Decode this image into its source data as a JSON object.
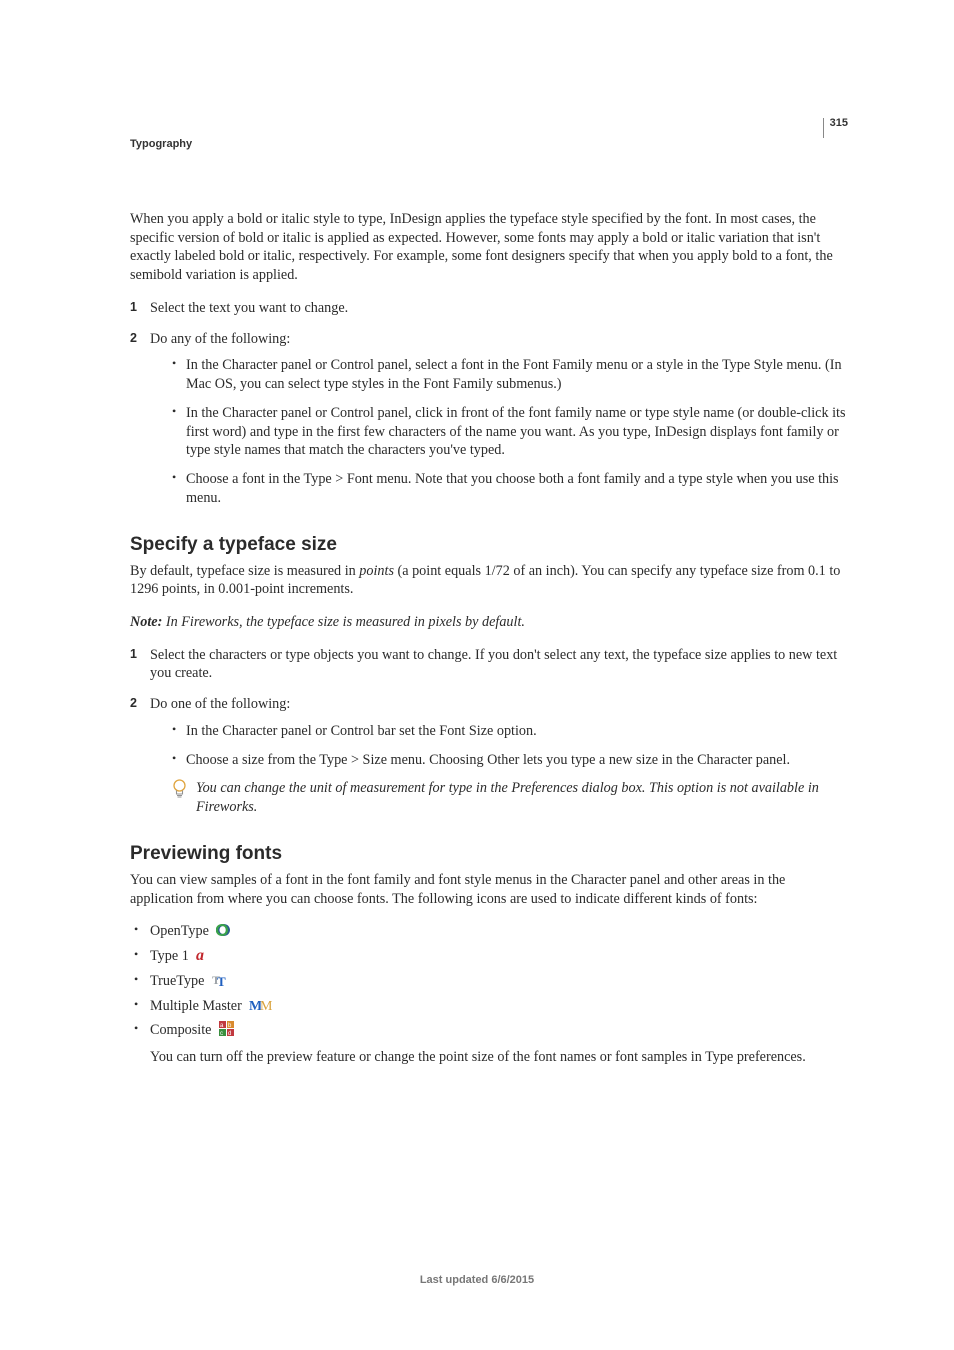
{
  "page_number": "315",
  "section": "Typography",
  "intro": "When you apply a bold or italic style to type, InDesign applies the typeface style specified by the font. In most cases, the specific version of bold or italic is applied as expected. However, some fonts may apply a bold or italic variation that isn't exactly labeled bold or italic, respectively. For example, some font designers specify that when you apply bold to a font, the semibold variation is applied.",
  "steps_a": {
    "s1": "Select the text you want to change.",
    "s2": "Do any of the following:",
    "s2_bullets": [
      "In the Character panel or Control panel, select a font in the Font Family menu or a style in the Type Style menu. (In Mac OS, you can select type styles in the Font Family submenus.)",
      "In the Character panel or Control panel, click in front of the font family name or type style name (or double-click its first word) and type in the first few characters of the name you want. As you type, InDesign displays font family or type style names that match the characters you've typed.",
      "Choose a font in the Type > Font menu. Note that you choose both a font family and a type style when you use this menu."
    ]
  },
  "h_size": "Specify a typeface size",
  "size_p1_a": "By default, typeface size is measured in ",
  "size_p1_em": "points",
  "size_p1_b": " (a point equals 1/72 of an inch). You can specify any typeface size from 0.1 to 1296 points, in 0.001-point increments.",
  "size_note_label": "Note: ",
  "size_note_text": "In Fireworks, the typeface size is measured in pixels by default.",
  "steps_b": {
    "s1": "Select the characters or type objects you want to change. If you don't select any text, the typeface size applies to new text you create.",
    "s2": "Do one of the following:",
    "s2_bullets": [
      "In the Character panel or Control bar set the Font Size option.",
      "Choose a size from the Type > Size menu. Choosing Other lets you type a new size in the Character panel."
    ],
    "tip": "You can change the unit of measurement for type in the Preferences dialog box. This option is not available in Fireworks."
  },
  "h_preview": "Previewing fonts",
  "preview_p1": "You can view samples of a font in the font family and font style menus in the Character panel and other areas in the application from where you can choose fonts. The following icons are used to indicate different kinds of fonts:",
  "font_types": {
    "opentype": "OpenType ",
    "type1": "Type 1 ",
    "truetype": "TrueType ",
    "mm": "Multiple Master ",
    "composite": "Composite "
  },
  "preview_p2": "You can turn off the preview feature or change the point size of the font names or font samples in Type preferences.",
  "footer": "Last updated 6/6/2015"
}
